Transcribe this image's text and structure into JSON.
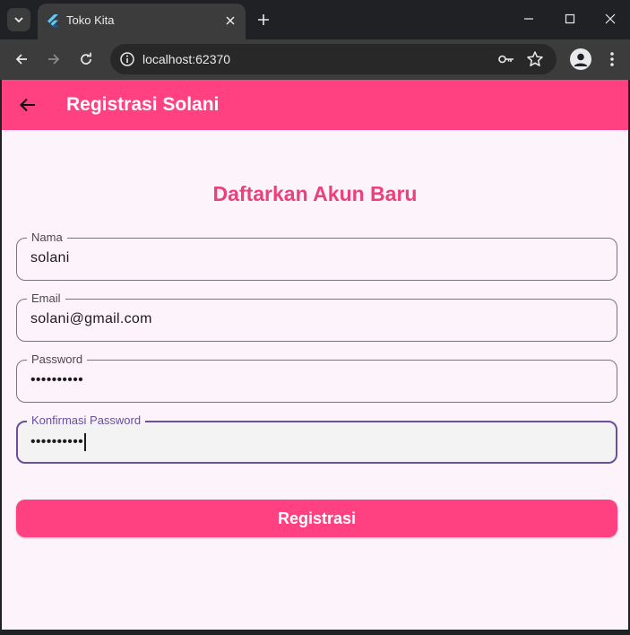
{
  "browser": {
    "tab_title": "Toko Kita",
    "url": "localhost:62370",
    "new_tab_label": "+"
  },
  "appbar": {
    "title": "Registrasi Solani"
  },
  "form": {
    "heading": "Daftarkan Akun Baru",
    "fields": [
      {
        "label": "Nama",
        "value": "solani"
      },
      {
        "label": "Email",
        "value": "solani@gmail.com"
      },
      {
        "label": "Password",
        "value": "••••••••••"
      },
      {
        "label": "Konfirmasi Password",
        "value": "••••••••••"
      }
    ],
    "submit_label": "Registrasi"
  },
  "colors": {
    "accent": "#ff4081",
    "heading": "#ec407a",
    "focus": "#6a4ea0",
    "background": "#fdf4fb"
  },
  "icons": [
    "tab-search-icon",
    "flutter-favicon-icon",
    "close-icon",
    "plus-icon",
    "minimize-icon",
    "maximize-icon",
    "window-close-icon",
    "back-arrow-icon",
    "forward-arrow-icon",
    "reload-icon",
    "info-icon",
    "key-icon",
    "star-icon",
    "profile-icon",
    "more-vert-icon",
    "arrow-back-icon"
  ]
}
